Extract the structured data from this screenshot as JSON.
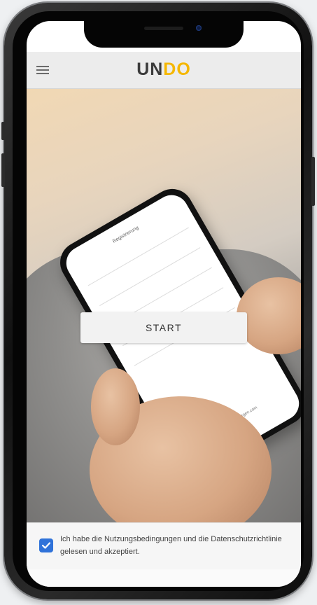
{
  "app": {
    "logo_prefix": "UN",
    "logo_accent": "DO",
    "brand_accent_color": "#f5b700"
  },
  "header": {
    "menu_icon": "hamburger-menu-icon"
  },
  "main": {
    "start_label": "START"
  },
  "consent": {
    "checked": true,
    "text": "Ich habe die Nutzungsbedingungen und die Datenschutzrichtlinie gelesen und akzeptiert."
  },
  "photo": {
    "inner_screen_title": "Registrierung",
    "inner_screen_footer": "Sponsored by entsorgen.com"
  }
}
